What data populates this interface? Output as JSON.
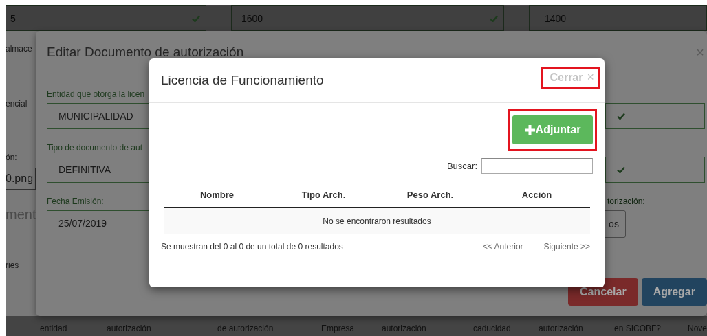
{
  "background_page": {
    "top_fields": [
      {
        "value": "5",
        "valid": true
      },
      {
        "value": "1600",
        "valid": true
      },
      {
        "value": "1400",
        "valid": false
      }
    ],
    "side_items": [
      {
        "kind": "text",
        "text": "almace"
      },
      {
        "kind": "text",
        "text": "encial"
      },
      {
        "kind": "text",
        "text": "ón:"
      },
      {
        "kind": "field",
        "text": "0.png"
      },
      {
        "kind": "text",
        "text": "ment"
      },
      {
        "kind": "text",
        "text": "ries"
      }
    ],
    "table_headers": [
      "entidad",
      "autorización",
      "de autorización",
      "Empresa",
      "autorización",
      "caducidad",
      "autorización",
      "en SICOBF?",
      "Nove"
    ]
  },
  "edit_dialog": {
    "title": "Editar Documento de autorización",
    "close_icon": "×",
    "left_fields": [
      {
        "label": "Entidad que otorga la licen",
        "value": "MUNICIPALIDAD"
      },
      {
        "label": "Tipo de documento de aut",
        "value": "DEFINITIVA"
      },
      {
        "label": "Fecha Emisión:",
        "value": "25/07/2019"
      }
    ],
    "right_fields": [
      {
        "valid": true
      },
      {
        "valid": true
      },
      {
        "label": "torización:",
        "value": "os",
        "valid": false
      }
    ],
    "buttons": [
      {
        "kind": "danger",
        "label": "Cancelar"
      },
      {
        "kind": "primary",
        "label": "Agregar"
      }
    ]
  },
  "file_dialog": {
    "title": "Licencia de Funcionamiento",
    "close": {
      "label": "Cerrar",
      "icon": "×",
      "highlighted": true
    },
    "attach": {
      "label": "Adjuntar",
      "highlighted": true
    },
    "search_label": "Buscar:",
    "columns": [
      "Nombre",
      "Tipo Arch.",
      "Peso Arch.",
      "Acción"
    ],
    "empty_message": "No se encontraron resultados",
    "summary": "Se muestran del 0 al 0 de un total de 0 resultados",
    "pagination": [
      "<< Anterior",
      "Siguiente >>"
    ]
  }
}
